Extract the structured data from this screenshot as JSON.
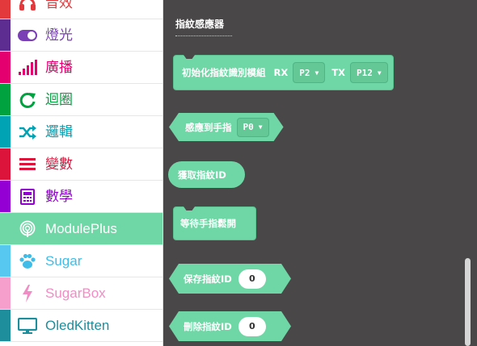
{
  "sidebar": {
    "items": [
      {
        "label": "音效",
        "color": "#e4393c",
        "stripe": "#e4393c",
        "icon": "headphones-icon"
      },
      {
        "label": "燈光",
        "color": "#7a3fb5",
        "stripe": "#5d2d91",
        "icon": "toggle-icon"
      },
      {
        "label": "廣播",
        "color": "#e4006f",
        "stripe": "#e4006f",
        "icon": "signal-bars-icon"
      },
      {
        "label": "迴圈",
        "color": "#00a23f",
        "stripe": "#00a23f",
        "icon": "loop-arrow-icon"
      },
      {
        "label": "邏輯",
        "color": "#00a3b4",
        "stripe": "#00a3b4",
        "icon": "shuffle-icon"
      },
      {
        "label": "變數",
        "color": "#dc143c",
        "stripe": "#dc143c",
        "icon": "list-lines-icon"
      },
      {
        "label": "數學",
        "color": "#9400d3",
        "stripe": "#9400d3",
        "icon": "calculator-icon"
      },
      {
        "label": "ModulePlus",
        "color": "#ffffff",
        "stripe": "#6fd6a5",
        "icon": "fingerprint-icon",
        "selected": true
      },
      {
        "label": "Sugar",
        "color": "#3fbde8",
        "stripe": "#57c8f0",
        "icon": "paw-icon"
      },
      {
        "label": "SugarBox",
        "color": "#f08dc4",
        "stripe": "#f69fcd",
        "icon": "lightning-icon"
      },
      {
        "label": "OledKitten",
        "color": "#1f8e9c",
        "stripe": "#1f8e9c",
        "icon": "monitor-icon"
      }
    ]
  },
  "workspace": {
    "title": "指紋感應器",
    "init_block": {
      "label": "初始化指紋識別模組",
      "rx_label": "RX",
      "rx_value": "P2",
      "tx_label": "TX",
      "tx_value": "P12"
    },
    "sense_block": {
      "label": "感應到手指",
      "pin_value": "P0"
    },
    "get_id_block": {
      "label": "獲取指紋ID"
    },
    "wait_block": {
      "label": "等待手指鬆開"
    },
    "save_block": {
      "label": "保存指紋ID",
      "value": "0"
    },
    "delete_block": {
      "label": "刪除指紋ID",
      "value": "0"
    }
  },
  "colors": {
    "workspace_bg": "#4a4748",
    "block": "#6fd6a5",
    "selected_category": "#6fd6a5"
  }
}
